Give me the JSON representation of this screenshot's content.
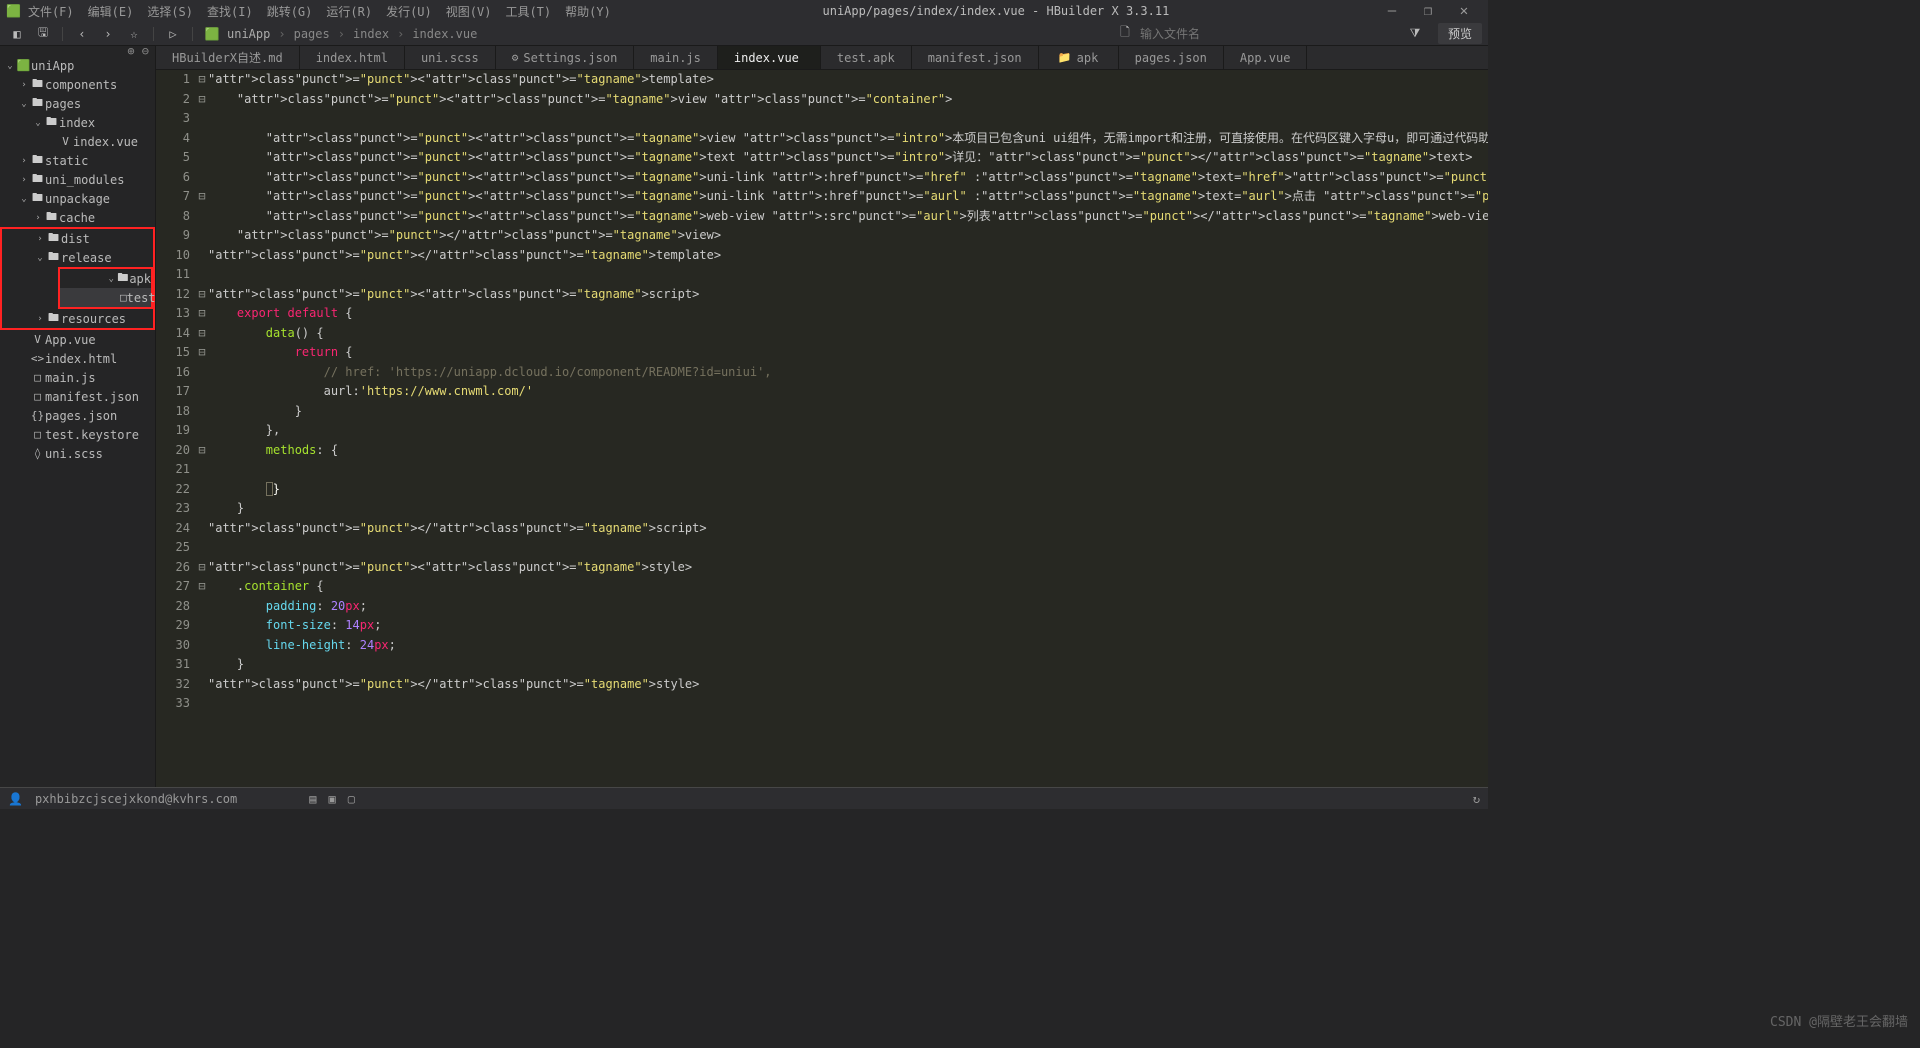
{
  "app": {
    "title_path": "uniApp/pages/index/index.vue",
    "title_app": "HBuilder X 3.3.11"
  },
  "menus": [
    "文件(F)",
    "编辑(E)",
    "选择(S)",
    "查找(I)",
    "跳转(G)",
    "运行(R)",
    "发行(U)",
    "视图(V)",
    "工具(T)",
    "帮助(Y)"
  ],
  "breadcrumb": [
    "uniApp",
    "pages",
    "index",
    "index.vue"
  ],
  "filename_placeholder": "输入文件名",
  "preview_label": "预览",
  "tree": {
    "root": "uniApp",
    "items": [
      {
        "d": 1,
        "t": "f",
        "exp": ">",
        "lbl": "components"
      },
      {
        "d": 1,
        "t": "f",
        "exp": "v",
        "lbl": "pages"
      },
      {
        "d": 2,
        "t": "f",
        "exp": "v",
        "lbl": "index"
      },
      {
        "d": 3,
        "t": "file",
        "ic": "V",
        "lbl": "index.vue"
      },
      {
        "d": 1,
        "t": "f",
        "exp": ">",
        "lbl": "static"
      },
      {
        "d": 1,
        "t": "f",
        "exp": ">",
        "lbl": "uni_modules"
      },
      {
        "d": 1,
        "t": "f",
        "exp": "v",
        "lbl": "unpackage"
      },
      {
        "d": 2,
        "t": "f",
        "exp": ">",
        "lbl": "cache"
      }
    ],
    "highlight_group": [
      {
        "d": 2,
        "t": "f",
        "exp": ">",
        "lbl": "dist"
      },
      {
        "d": 2,
        "t": "f",
        "exp": "v",
        "lbl": "release"
      },
      {
        "d": 3,
        "t": "f",
        "exp": "v",
        "lbl": "apk",
        "boxed_start": true
      },
      {
        "d": 4,
        "t": "file",
        "ic": "□",
        "lbl": "test.apk",
        "selected": true,
        "boxed_end": true
      },
      {
        "d": 2,
        "t": "f",
        "exp": ">",
        "lbl": "resources"
      }
    ],
    "after": [
      {
        "d": 1,
        "t": "file",
        "ic": "V",
        "lbl": "App.vue"
      },
      {
        "d": 1,
        "t": "file",
        "ic": "<>",
        "lbl": "index.html"
      },
      {
        "d": 1,
        "t": "file",
        "ic": "□",
        "lbl": "main.js"
      },
      {
        "d": 1,
        "t": "file",
        "ic": "□",
        "lbl": "manifest.json"
      },
      {
        "d": 1,
        "t": "file",
        "ic": "{}",
        "lbl": "pages.json"
      },
      {
        "d": 1,
        "t": "file",
        "ic": "□",
        "lbl": "test.keystore"
      },
      {
        "d": 1,
        "t": "file",
        "ic": "◊",
        "lbl": "uni.scss"
      }
    ]
  },
  "tabs": [
    {
      "lbl": "HBuilderX自述.md"
    },
    {
      "lbl": "index.html"
    },
    {
      "lbl": "uni.scss"
    },
    {
      "lbl": "Settings.json",
      "ic": "⚙"
    },
    {
      "lbl": "main.js"
    },
    {
      "lbl": "index.vue",
      "active": true
    },
    {
      "lbl": "test.apk"
    },
    {
      "lbl": "manifest.json"
    },
    {
      "lbl": "apk",
      "ic": "📁"
    },
    {
      "lbl": "pages.json"
    },
    {
      "lbl": "App.vue"
    }
  ],
  "code": {
    "lines": 33,
    "src": {
      "l1": "<template>",
      "l2": "    <view class=\"container\">",
      "l4": "        <view class=\"intro\">本项目已包含uni ui组件，无需import和注册，可直接使用。在代码区键入字母u，即可通过代码助手列出所有可用组件。光标置于组件名称处按F1，即可查看组件文",
      "l5": "        <text class=\"intro\">详见：</text>",
      "l6": "        <uni-link :href=\"href\" :text=\"href\"></uni-link>",
      "l7": "        <uni-link :href=\"aurl\" :text=\"aurl\">点击 </uni-link>",
      "l8": "        <web-view :src=\"aurl\">列表</web-view>",
      "l9": "    </view>",
      "l10": "</template>",
      "l12": "<script>",
      "l13": "    export default {",
      "l14": "        data() {",
      "l15": "            return {",
      "l16": "                // href: 'https://uniapp.dcloud.io/component/README?id=uniui',",
      "l17": "                aurl:'https://www.cnwml.com/'",
      "l18": "            }",
      "l19": "        },",
      "l20": "        methods: {",
      "l22": "        }",
      "l23": "    }",
      "l24": "</script>",
      "l26": "<style>",
      "l27": "    .container {",
      "l28": "        padding: 20px;",
      "l29": "        font-size: 14px;",
      "l30": "        line-height: 24px;",
      "l31": "    }",
      "l32": "</style>"
    }
  },
  "status": {
    "user": "pxhbibzcjscejxkond@kvhrs.com",
    "watermark": "CSDN @隔壁老王会翻墙"
  }
}
